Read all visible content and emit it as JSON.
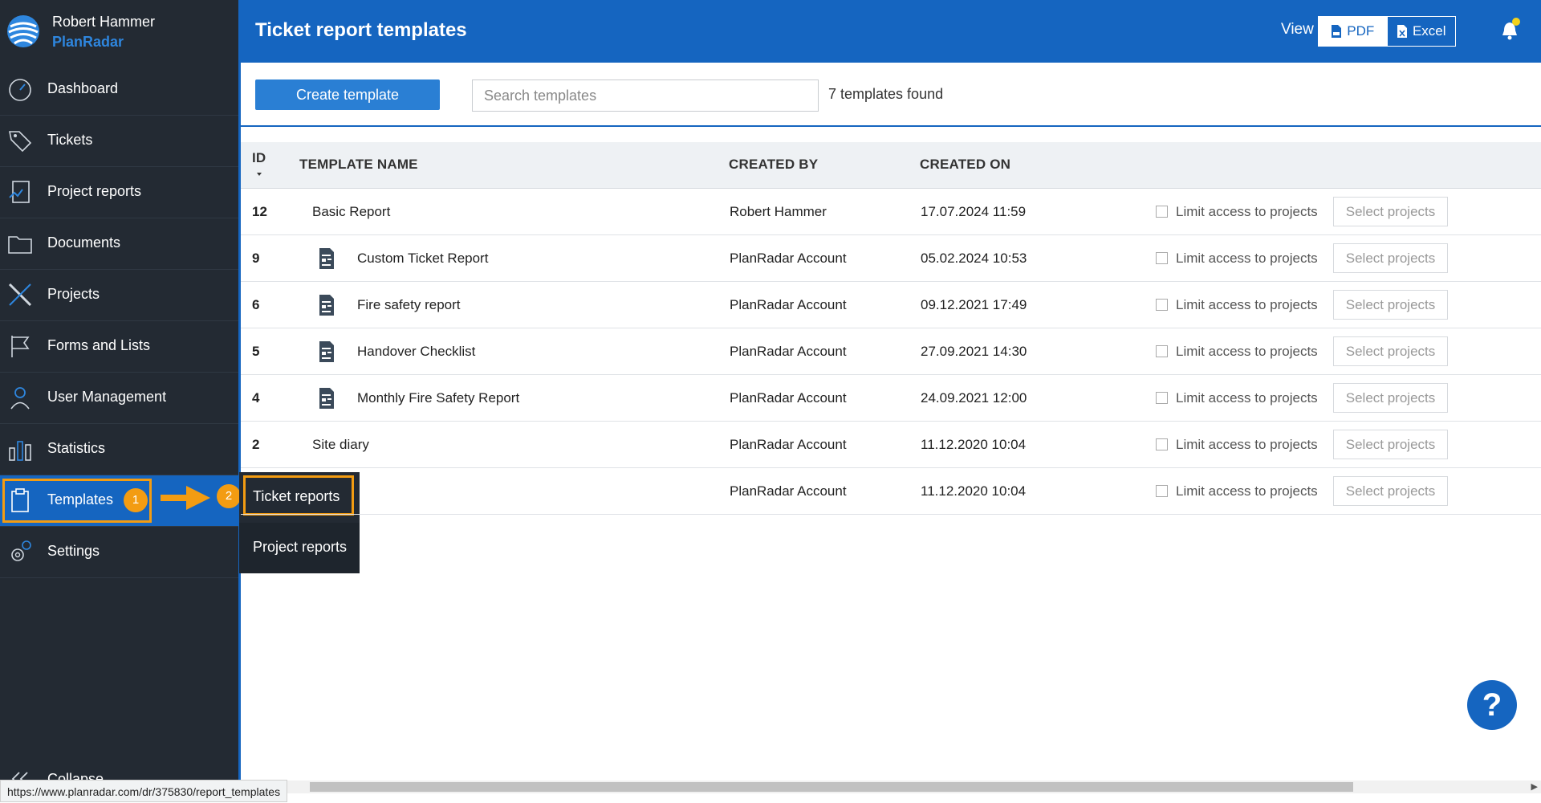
{
  "user": {
    "name": "Robert Hammer",
    "brand": "PlanRadar"
  },
  "sidebar": {
    "items": [
      {
        "label": "Dashboard",
        "icon": "speedometer-icon"
      },
      {
        "label": "Tickets",
        "icon": "tag-icon"
      },
      {
        "label": "Project reports",
        "icon": "report-icon"
      },
      {
        "label": "Documents",
        "icon": "folder-icon"
      },
      {
        "label": "Projects",
        "icon": "ruler-pencil-icon"
      },
      {
        "label": "Forms and Lists",
        "icon": "flag-icon"
      },
      {
        "label": "User Management",
        "icon": "user-icon"
      },
      {
        "label": "Statistics",
        "icon": "bar-chart-icon"
      },
      {
        "label": "Templates",
        "icon": "clipboard-icon",
        "active": true
      },
      {
        "label": "Settings",
        "icon": "gear-icon"
      }
    ],
    "collapse_label": "Collapse"
  },
  "annotations": {
    "step1": "1",
    "step2": "2"
  },
  "submenu": {
    "items": [
      "Ticket reports",
      "Project reports"
    ]
  },
  "header": {
    "title": "Ticket report templates",
    "view_label": "View",
    "pdf_label": "PDF",
    "excel_label": "Excel"
  },
  "toolbar": {
    "create_label": "Create template",
    "search_placeholder": "Search templates",
    "search_value": "",
    "found_text": "7 templates found"
  },
  "table": {
    "columns": {
      "id": "ID",
      "name": "TEMPLATE NAME",
      "created_by": "CREATED BY",
      "created_on": "CREATED ON"
    },
    "limit_label": "Limit access to projects",
    "select_label": "Select projects",
    "rows": [
      {
        "id": "12",
        "name": "Basic Report",
        "created_by": "Robert Hammer",
        "created_on": "17.07.2024 11:59",
        "icon": false
      },
      {
        "id": "9",
        "name": "Custom Ticket Report",
        "created_by": "PlanRadar Account",
        "created_on": "05.02.2024 10:53",
        "icon": true
      },
      {
        "id": "6",
        "name": "Fire safety report",
        "created_by": "PlanRadar Account",
        "created_on": "09.12.2021 17:49",
        "icon": true
      },
      {
        "id": "5",
        "name": "Handover Checklist",
        "created_by": "PlanRadar Account",
        "created_on": "27.09.2021 14:30",
        "icon": true
      },
      {
        "id": "4",
        "name": "Monthly Fire Safety Report",
        "created_by": "PlanRadar Account",
        "created_on": "24.09.2021 12:00",
        "icon": true
      },
      {
        "id": "2",
        "name": "Site diary",
        "created_by": "PlanRadar Account",
        "created_on": "11.12.2020 10:04",
        "icon": false
      },
      {
        "id": "",
        "name": "",
        "created_by": "PlanRadar Account",
        "created_on": "11.12.2020 10:04",
        "icon": false
      }
    ]
  },
  "help": {
    "label": "?"
  },
  "status_bar": {
    "url": "https://www.planradar.com/dr/375830/report_templates"
  },
  "colors": {
    "primary": "#1565c0",
    "sidebar": "#232a33",
    "annotation": "#f39c12",
    "button": "#2a7fd4"
  }
}
